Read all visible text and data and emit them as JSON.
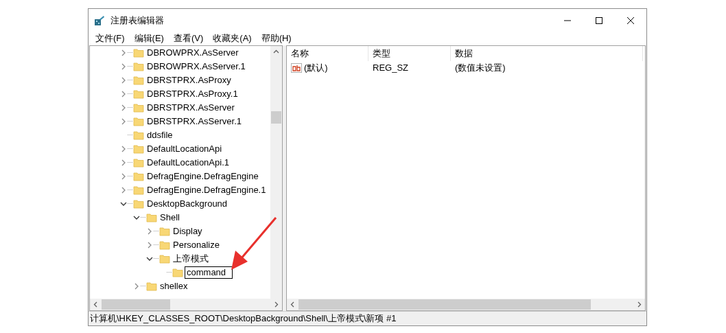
{
  "window": {
    "title": "注册表编辑器"
  },
  "menu": [
    "文件(F)",
    "编辑(E)",
    "查看(V)",
    "收藏夹(A)",
    "帮助(H)"
  ],
  "tree": [
    {
      "label": "DBROWPRX.AsServer",
      "kind": "branch",
      "expanded": false
    },
    {
      "label": "DBROWPRX.AsServer.1",
      "kind": "branch",
      "expanded": false
    },
    {
      "label": "DBRSTPRX.AsProxy",
      "kind": "branch",
      "expanded": false
    },
    {
      "label": "DBRSTPRX.AsProxy.1",
      "kind": "branch",
      "expanded": false
    },
    {
      "label": "DBRSTPRX.AsServer",
      "kind": "branch",
      "expanded": false
    },
    {
      "label": "DBRSTPRX.AsServer.1",
      "kind": "branch",
      "expanded": false
    },
    {
      "label": "ddsfile",
      "kind": "leaf"
    },
    {
      "label": "DefaultLocationApi",
      "kind": "branch",
      "expanded": false
    },
    {
      "label": "DefaultLocationApi.1",
      "kind": "branch",
      "expanded": false
    },
    {
      "label": "DefragEngine.DefragEngine",
      "kind": "branch",
      "expanded": false
    },
    {
      "label": "DefragEngine.DefragEngine.1",
      "kind": "branch",
      "expanded": false
    },
    {
      "label": "DesktopBackground",
      "kind": "branch",
      "expanded": true,
      "children": [
        {
          "label": "Shell",
          "kind": "branch",
          "expanded": true,
          "children": [
            {
              "label": "Display",
              "kind": "branch",
              "expanded": false
            },
            {
              "label": "Personalize",
              "kind": "branch",
              "expanded": false
            },
            {
              "label": "上帝模式",
              "kind": "branch",
              "expanded": true,
              "children": [
                {
                  "label": "command",
                  "kind": "rename"
                }
              ]
            }
          ]
        },
        {
          "label": "shellex",
          "kind": "branch",
          "expanded": false
        }
      ]
    }
  ],
  "values_table": {
    "columns": [
      "名称",
      "类型",
      "数据"
    ],
    "rows": [
      {
        "name": "(默认)",
        "type": "REG_SZ",
        "data": "(数值未设置)"
      }
    ]
  },
  "status_bar": "计算机\\HKEY_CLASSES_ROOT\\DesktopBackground\\Shell\\上帝模式\\新项 #1"
}
